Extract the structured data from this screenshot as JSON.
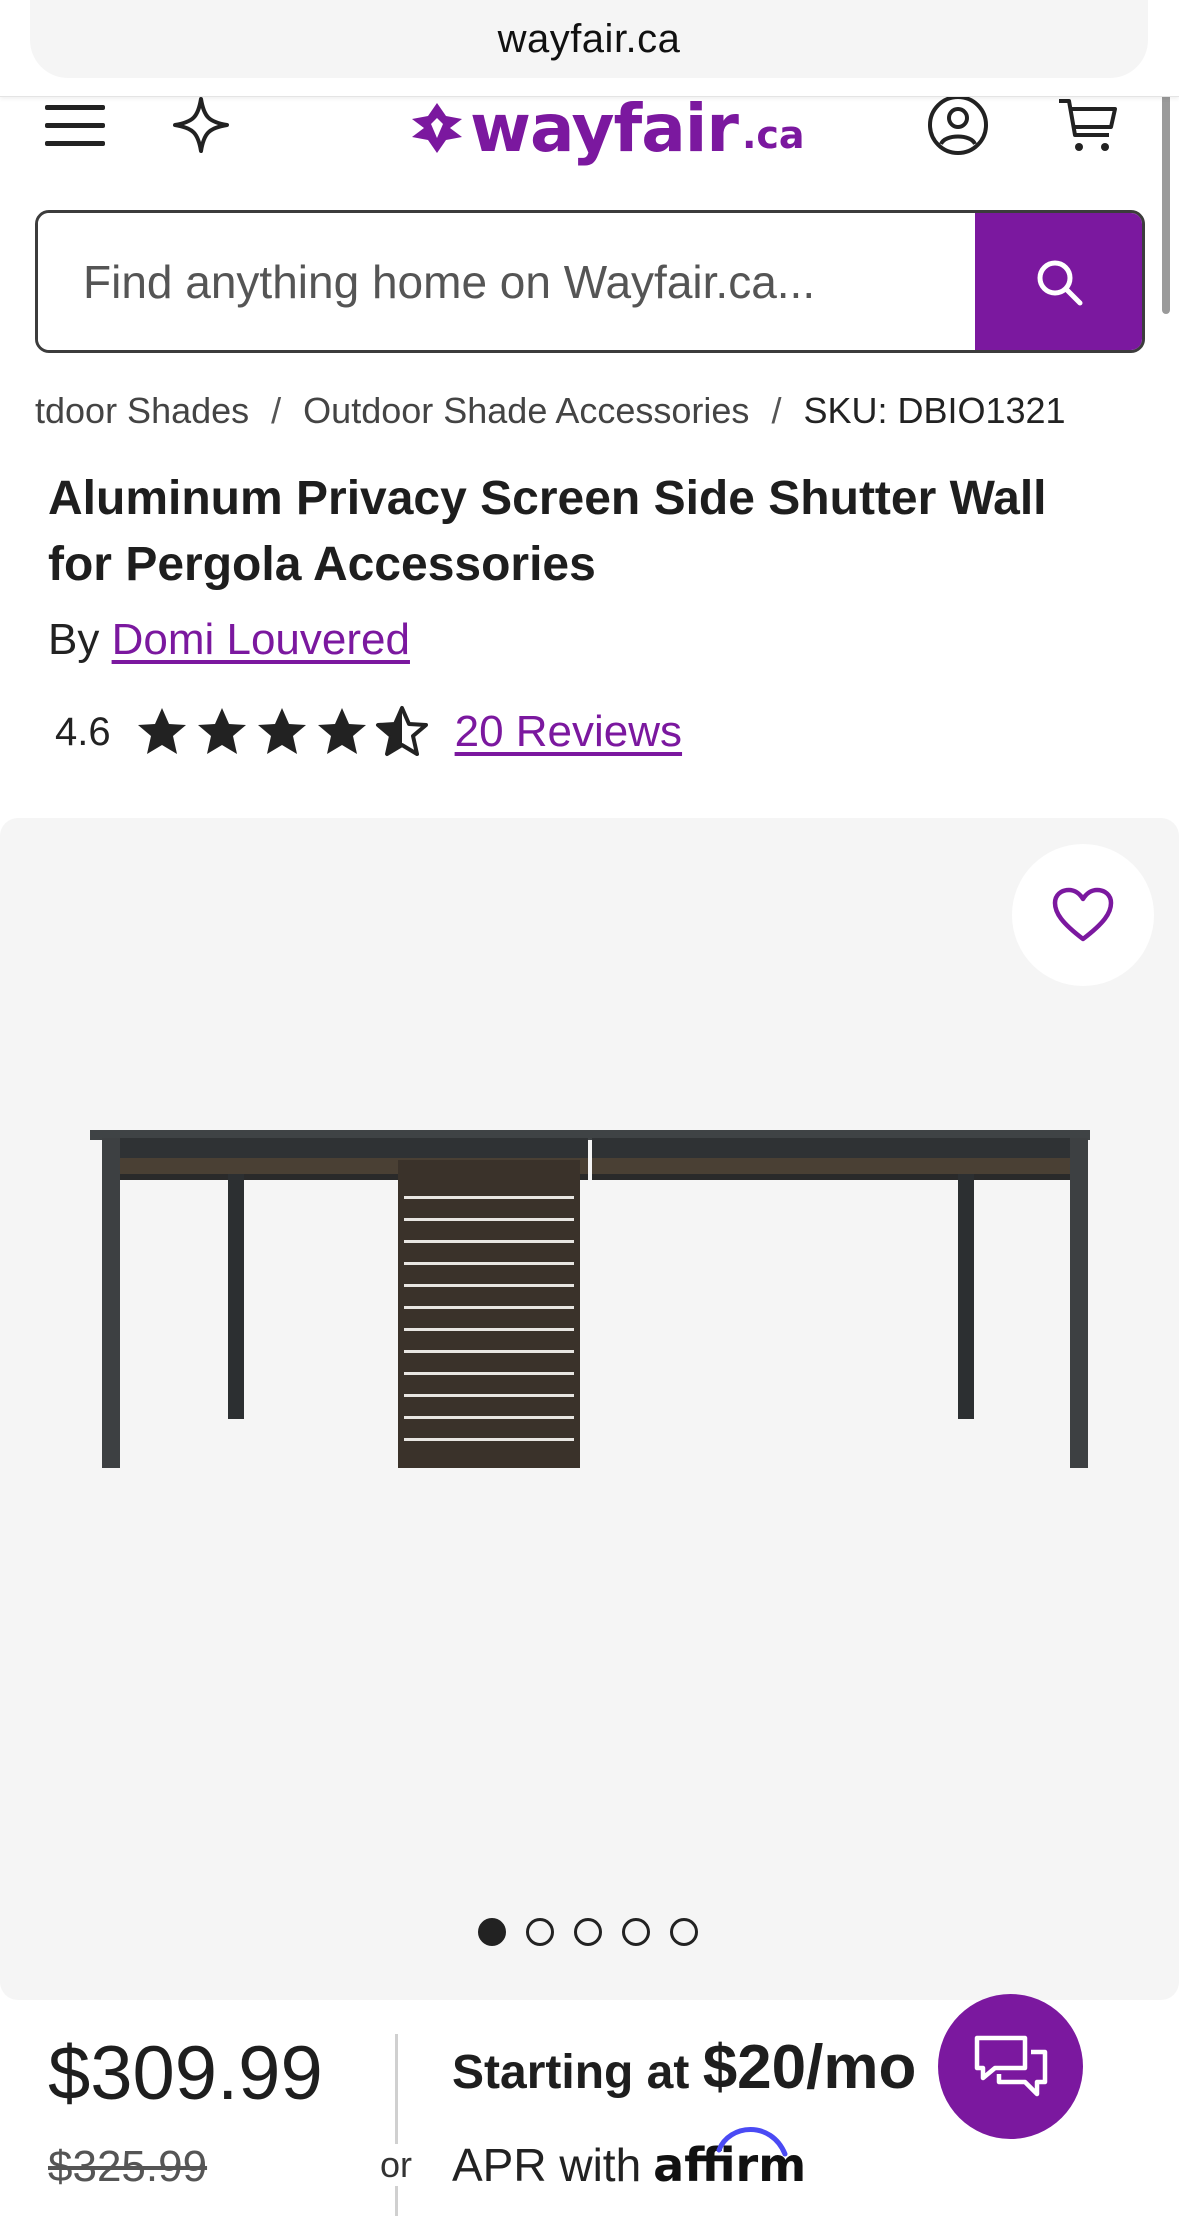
{
  "browser": {
    "url": "wayfair.ca"
  },
  "header": {
    "logo_text": "wayfair",
    "logo_suffix": ".ca"
  },
  "search": {
    "placeholder": "Find anything home on Wayfair.ca..."
  },
  "breadcrumb": {
    "items": [
      "tdoor Shades",
      "Outdoor Shade Accessories",
      "SKU: DBIO1321"
    ],
    "separator": "/"
  },
  "product": {
    "title": "Aluminum Privacy Screen Side Shutter Wall for Pergola Accessories",
    "by_label": "By",
    "brand": "Domi Louvered",
    "rating": "4.6",
    "rating_value": 4.6,
    "reviews_label": "20 Reviews",
    "image_count": 5,
    "active_image": 1
  },
  "pricing": {
    "price": "$309.99",
    "was_price": "$325.99",
    "or_label": "or",
    "financing_prefix": "Starting at",
    "financing_amount": "$20/mo",
    "apr_text": "APR with",
    "affirm": "affirm"
  },
  "colors": {
    "brand": "#7b189f",
    "text": "#1e1e1e",
    "gallery_bg": "#f5f5f5"
  }
}
